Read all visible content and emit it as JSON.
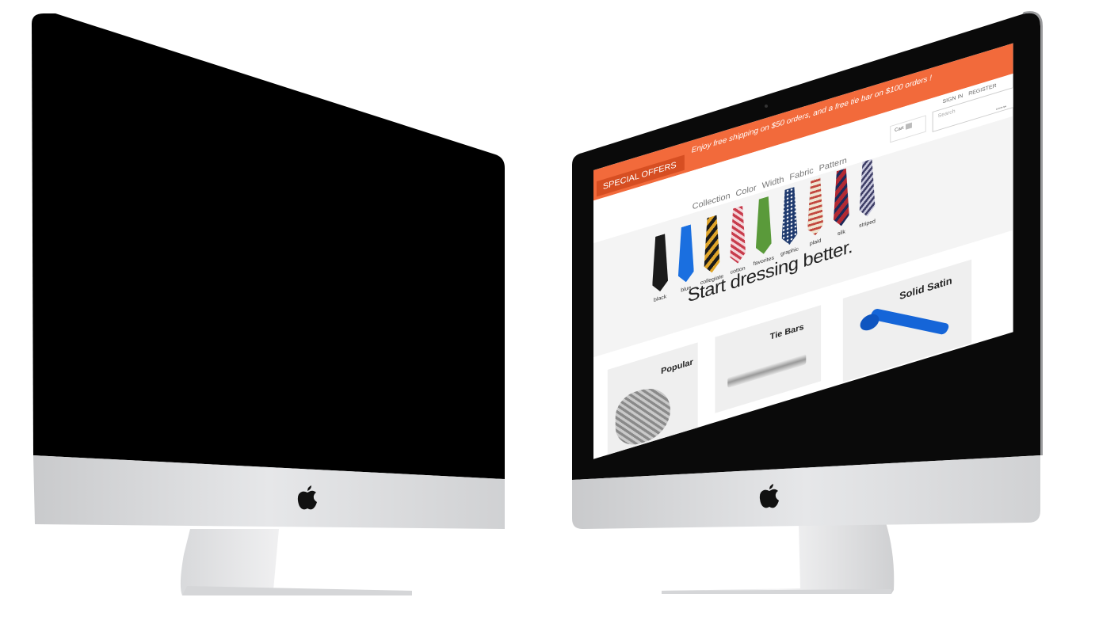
{
  "left_monitor": {
    "brand_icon": "apple-logo-icon"
  },
  "right_monitor": {
    "brand_icon": "apple-logo-icon",
    "site": {
      "promo": {
        "special_offers": "SPECIAL OFFERS",
        "message": "Enjoy free shipping on $50 orders, and a free tie bar on $100 orders !"
      },
      "header": {
        "sign_in": "SIGN IN",
        "register": "REGISTER",
        "search_placeholder": "Search",
        "cart_label": "Cart",
        "lorem": "Lorem Ips"
      },
      "nav": [
        "Collection",
        "Color",
        "Width",
        "Fabric",
        "Pattern"
      ],
      "ties": [
        {
          "label": "black",
          "color": "#1b1b1b"
        },
        {
          "label": "blue",
          "color": "#1a6fe0"
        },
        {
          "label": "collegiate",
          "color": "#d89a1d"
        },
        {
          "label": "cotton",
          "color": "#c83c4c"
        },
        {
          "label": "favorites",
          "color": "#5a9a3a"
        },
        {
          "label": "graphic",
          "color": "#1f3a6e"
        },
        {
          "label": "plaid",
          "color": "#c2493f"
        },
        {
          "label": "silk",
          "color": "#b22a33"
        },
        {
          "label": "striped",
          "color": "#6a6a8a"
        }
      ],
      "headline": "Start dressing better.",
      "cards": [
        {
          "title": "Popular"
        },
        {
          "title": "Tie Bars"
        },
        {
          "title": "Solid Satin"
        }
      ]
    }
  }
}
